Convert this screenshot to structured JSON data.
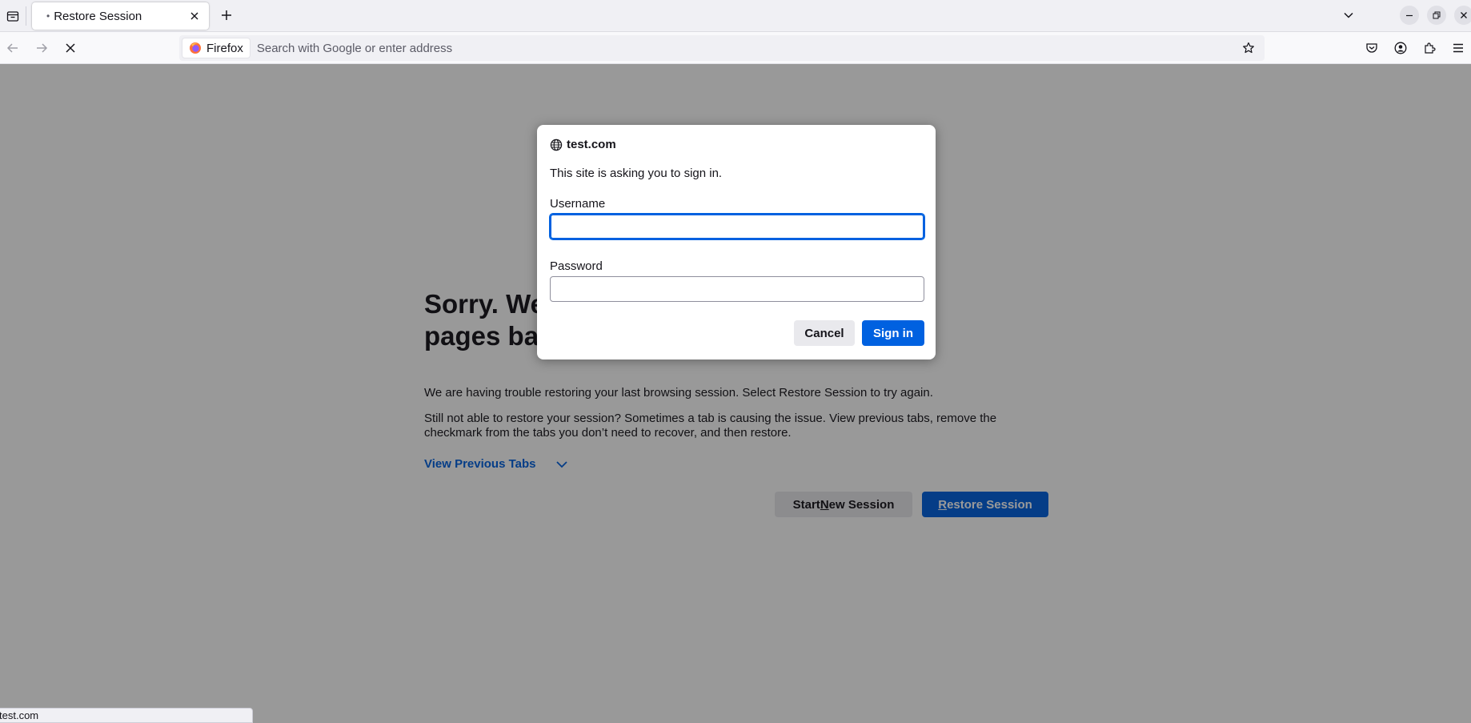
{
  "browser": {
    "tab": {
      "title": "Restore Session",
      "dot": "•",
      "close_icon": "close-icon"
    },
    "new_tab_icon": "plus-icon",
    "urlbar": {
      "identity_label": "Firefox",
      "placeholder": "Search with Google or enter address"
    }
  },
  "page": {
    "title": "Sorry. We’re having trouble getting your pages back.",
    "paragraph1": "We are having trouble restoring your last browsing session. Select Restore Session to try again.",
    "paragraph2": "Still not able to restore your session? Sometimes a tab is causing the issue. View previous tabs, remove the checkmark from the tabs you don’t need to recover, and then restore.",
    "view_previous_tabs": "View Previous Tabs",
    "start_new_session": {
      "before": "Start ",
      "accesskey": "N",
      "after": "ew Session"
    },
    "restore_session": {
      "accesskey": "R",
      "after": "estore Session"
    }
  },
  "dialog": {
    "host": "test.com",
    "message": "This site is asking you to sign in.",
    "username_label": "Username",
    "username_value": "",
    "password_label": "Password",
    "password_value": "",
    "cancel_label": "Cancel",
    "signin_label": "Sign in"
  },
  "status": {
    "text": "test.com"
  },
  "colors": {
    "accent": "#0061e0",
    "overlay": "rgba(12,12,13,0.42)"
  }
}
